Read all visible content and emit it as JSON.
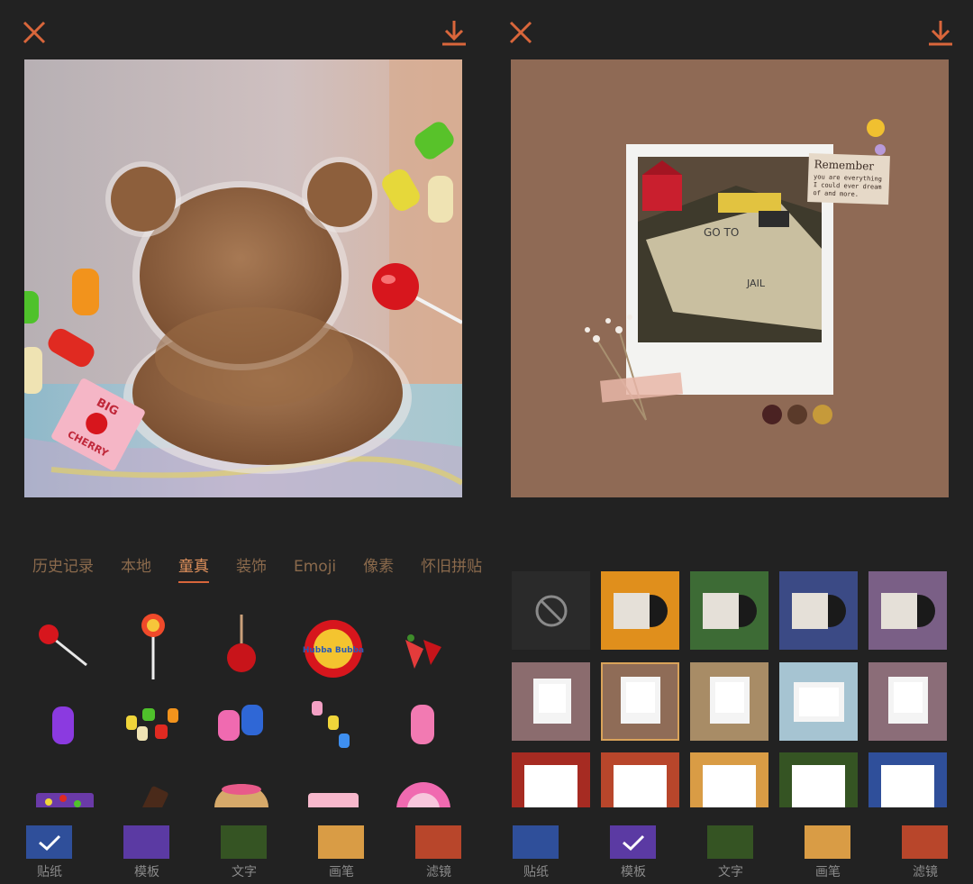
{
  "left_panel": {
    "categories": [
      {
        "label": "历史记录"
      },
      {
        "label": "本地"
      },
      {
        "label": "童真"
      },
      {
        "label": "装饰"
      },
      {
        "label": "Emoji"
      },
      {
        "label": "像素"
      },
      {
        "label": "怀旧拼贴"
      }
    ],
    "active_category": "童真",
    "candy_text": [
      "BIG",
      "CHERRY"
    ],
    "gum_text": "Hubba Bubba",
    "toolbar": [
      {
        "label": "贴纸",
        "color": "#2f4f9a",
        "selected": true
      },
      {
        "label": "模板",
        "color": "#5b3aa3",
        "selected": false
      },
      {
        "label": "文字",
        "color": "#355423",
        "selected": false
      },
      {
        "label": "画笔",
        "color": "#d99c45",
        "selected": false
      },
      {
        "label": "滤镜",
        "color": "#b8462b",
        "selected": false
      }
    ]
  },
  "right_panel": {
    "note_title": "Remember",
    "note_lines": [
      "you are everything",
      "I could ever dream",
      "of and more."
    ],
    "board_texts": [
      "GO TO",
      "JAIL"
    ],
    "toolbar": [
      {
        "label": "贴纸",
        "color": "#2f4f9a",
        "selected": false
      },
      {
        "label": "模板",
        "color": "#5b3aa3",
        "selected": true
      },
      {
        "label": "文字",
        "color": "#355423",
        "selected": false
      },
      {
        "label": "画笔",
        "color": "#d99c45",
        "selected": false
      },
      {
        "label": "滤镜",
        "color": "#b8462b",
        "selected": false
      }
    ],
    "template_colors": {
      "row1": [
        "#e08f1c",
        "#3d6b35",
        "#3b4a85",
        "#7a5f86"
      ],
      "row2": [
        "#8b6c6e",
        "#8f6c57",
        "#a88c66",
        "#a6c4d2",
        "#8b6d78"
      ],
      "row3": [
        "#a62b22",
        "#b8462b",
        "#d99c45",
        "#355423",
        "#2f4f9a"
      ]
    }
  }
}
